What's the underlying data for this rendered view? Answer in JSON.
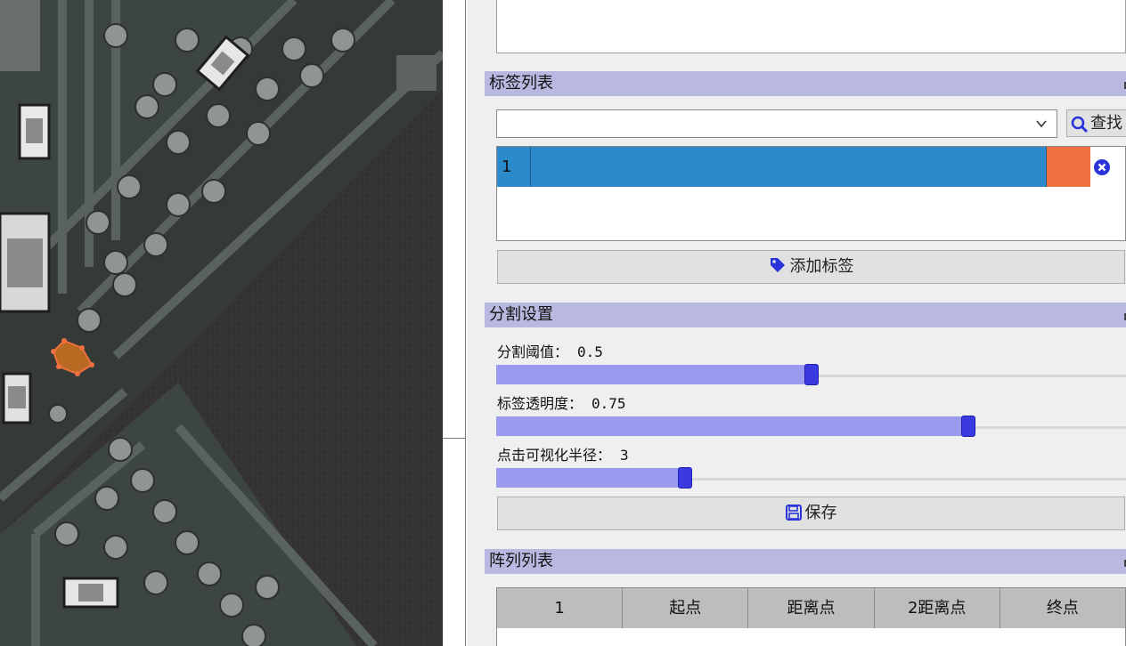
{
  "window": {
    "canvas_label": "PCB image view"
  },
  "tag_list": {
    "title": "标签列表",
    "search_value": "",
    "find_label": "查找",
    "rows": [
      {
        "id": "1",
        "color": "#f07040"
      }
    ],
    "add_label": "添加标签"
  },
  "segmentation": {
    "title": "分割设置",
    "threshold": {
      "label": "分割阈值：",
      "value": "0.5",
      "fraction": 0.5
    },
    "opacity": {
      "label": "标签透明度：",
      "value": "0.75",
      "fraction": 0.75
    },
    "radius": {
      "label": "点击可视化半径：",
      "value": "3",
      "fraction": 0.3
    },
    "save_label": "保存"
  },
  "array_list": {
    "title": "阵列列表",
    "columns": [
      "1",
      "起点",
      "距离点",
      "2距离点",
      "终点"
    ]
  },
  "colors": {
    "accent": "#3a3ae0",
    "dock_title": "#b8b8e0",
    "selected_row": "#2b8ac9"
  }
}
